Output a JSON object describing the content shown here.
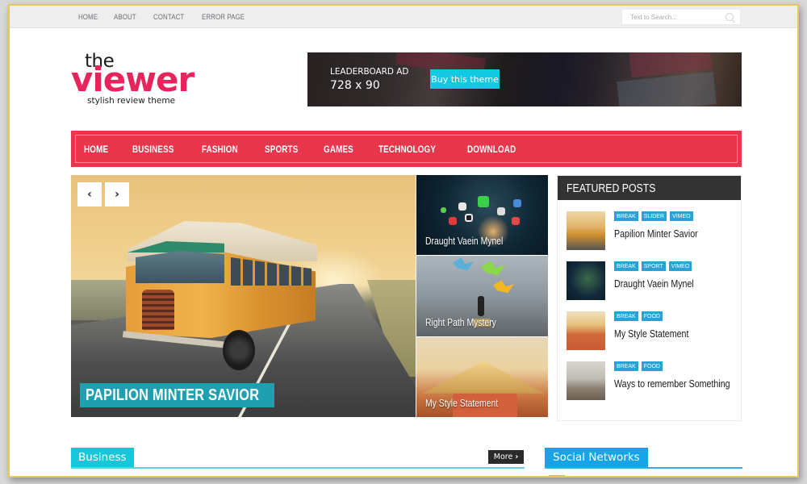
{
  "topbar": {
    "links": [
      "HOME",
      "ABOUT",
      "CONTACT",
      "ERROR PAGE"
    ],
    "search_placeholder": "Text to Search..."
  },
  "logo": {
    "line1": "the",
    "line2": "viewer",
    "tagline": "stylish review theme",
    "brand_color": "#e8245c"
  },
  "ad": {
    "label": "LEADERBOARD AD",
    "size": "728 x 90",
    "button": "Buy this theme",
    "button_color": "#12c8e2"
  },
  "main_nav": {
    "color": "#e8364d",
    "items": [
      "HOME",
      "BUSINESS",
      "FASHION",
      "SPORTS",
      "GAMES",
      "TECHNOLOGY",
      "DOWNLOAD"
    ]
  },
  "slider": {
    "prev_icon": "chevron-left-icon",
    "next_icon": "chevron-right-icon",
    "prev_glyph": "‹",
    "next_glyph": "›",
    "caption": "PAPILION MINTER SAVIOR",
    "caption_color": "#1fa0b0"
  },
  "side_tiles": [
    {
      "title": "Draught Vaein Mynel"
    },
    {
      "title": "Right Path Mystery"
    },
    {
      "title": "My Style Statement"
    }
  ],
  "featured": {
    "heading": "FEATURED POSTS",
    "tag_color": "#2aa2d6",
    "posts": [
      {
        "title": "Papilion Minter Savior",
        "tags": [
          "BREAK",
          "SLIDER",
          "VIMEO"
        ]
      },
      {
        "title": "Draught Vaein Mynel",
        "tags": [
          "BREAK",
          "SPORT",
          "VIMEO"
        ]
      },
      {
        "title": "My Style Statement",
        "tags": [
          "BREAK",
          "FOOD"
        ]
      },
      {
        "title": "Ways to remember Something",
        "tags": [
          "BREAK",
          "FOOD"
        ]
      }
    ]
  },
  "sections": {
    "business": {
      "title": "Business",
      "more": "More",
      "more_glyph": "›",
      "color": "#18c6da"
    },
    "social": {
      "title": "Social Networks",
      "color": "#17a3e8"
    }
  }
}
